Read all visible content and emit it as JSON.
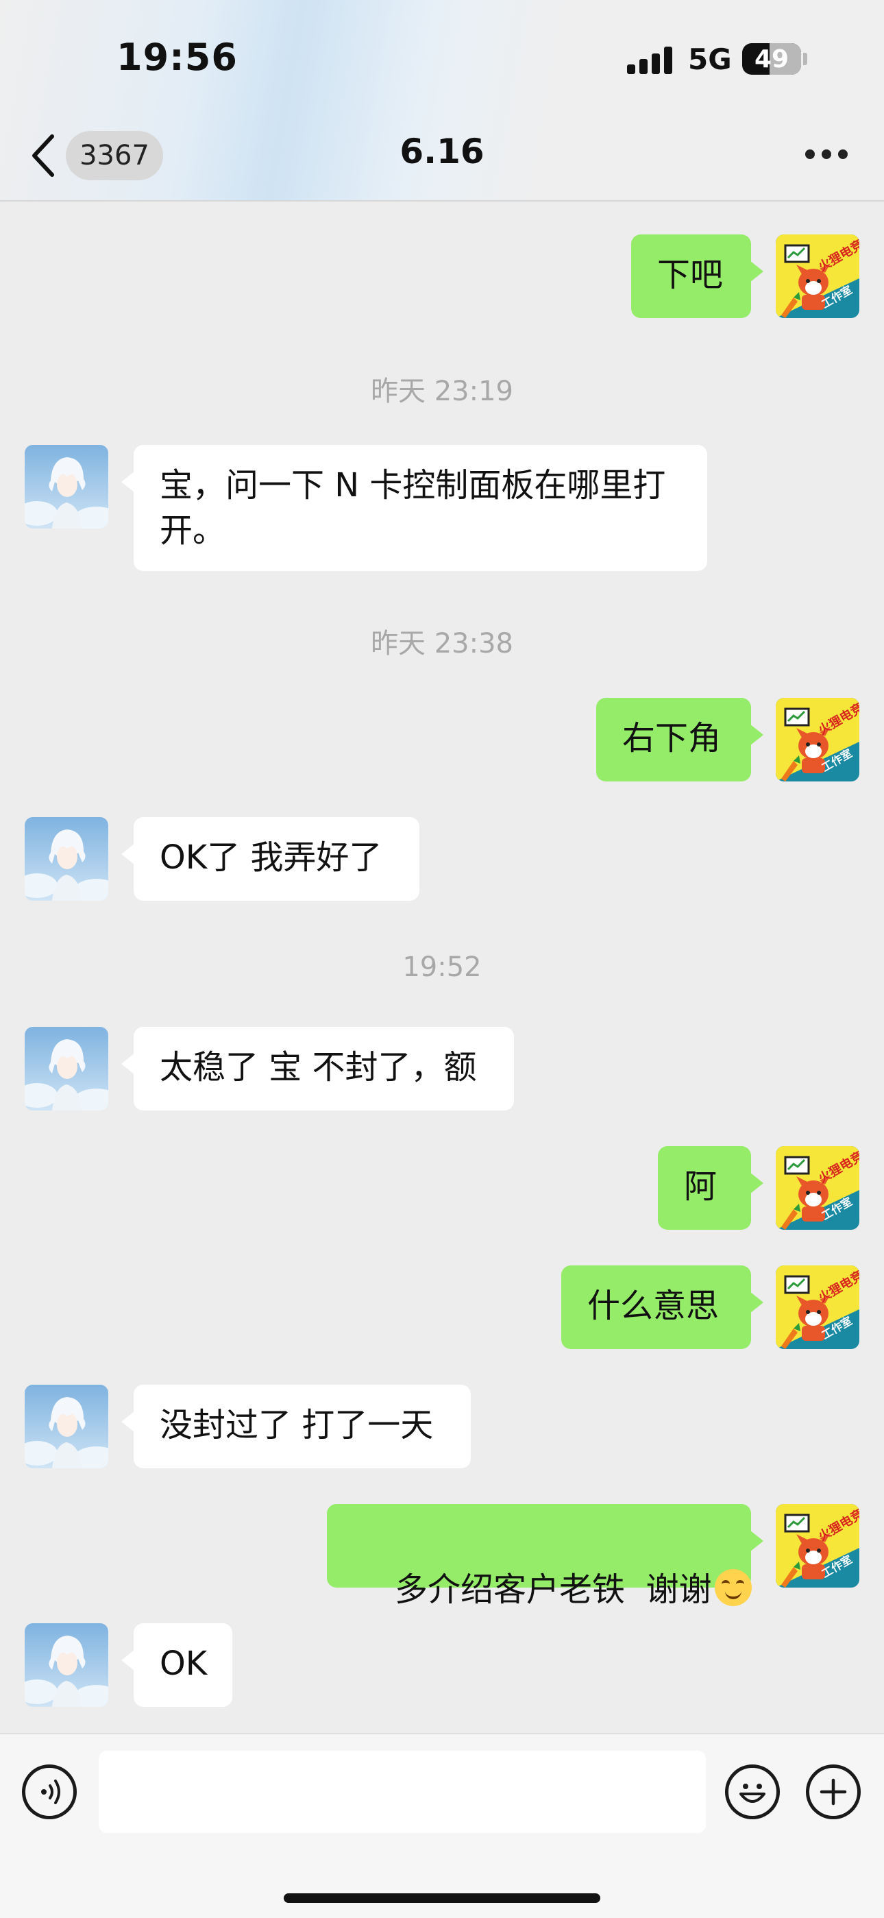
{
  "status_bar": {
    "time": "19:56",
    "network": "5G",
    "battery": "49"
  },
  "nav": {
    "unread_count": "3367",
    "title": "6.16"
  },
  "messages": [
    {
      "side": "out",
      "text": "下吧"
    },
    {
      "type": "timestamp",
      "text": "昨天 23:19"
    },
    {
      "side": "in",
      "line1": "宝，问一下 N 卡控制面板在哪里打",
      "line2": "开。"
    },
    {
      "type": "timestamp",
      "text": "昨天 23:38"
    },
    {
      "side": "out",
      "text": "右下角"
    },
    {
      "side": "in",
      "text": "OK了 我弄好了"
    },
    {
      "type": "timestamp",
      "text": "19:52"
    },
    {
      "side": "in",
      "text": "太稳了 宝 不封了，额"
    },
    {
      "side": "out",
      "text": "阿"
    },
    {
      "side": "out",
      "text": "什么意思"
    },
    {
      "side": "in",
      "text": "没封过了 打了一天"
    },
    {
      "side": "out",
      "text": "多介绍客户老铁  谢谢",
      "emoji": "flushed-smile-emoji"
    },
    {
      "side": "in",
      "text": "OK"
    }
  ],
  "avatars": {
    "self_avatar_text_top": "火狸电竞",
    "self_avatar_text_bottom": "工作室"
  },
  "input_bar": {
    "text_value": ""
  },
  "colors": {
    "out_bubble": "#95ec69",
    "in_bubble": "#ffffff",
    "background": "#ededed"
  }
}
